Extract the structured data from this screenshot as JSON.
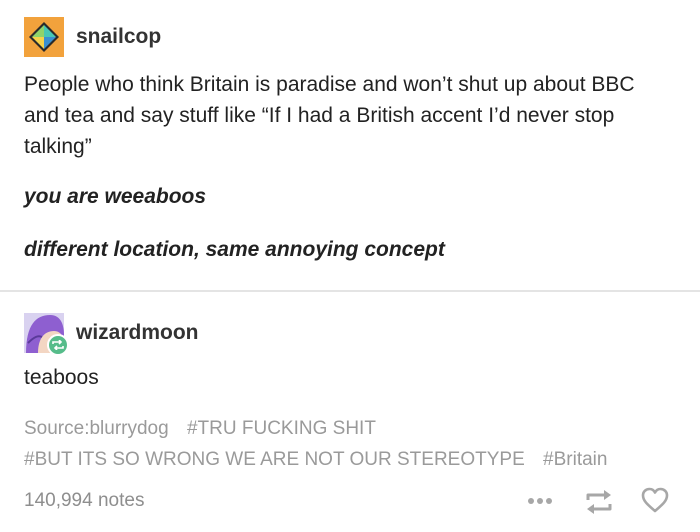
{
  "post": {
    "reblogs": [
      {
        "username": "snailcop",
        "avatar_icon": "geometric-logo-avatar",
        "body": "People who think Britain is paradise and won’t shut up about BBC and tea and say stuff like “If I had a British accent I’d never stop talking”",
        "emphasis": [
          "you are weeaboos",
          "different location, same annoying concept"
        ]
      },
      {
        "username": "wizardmoon",
        "avatar_icon": "purple-hair-character-avatar",
        "badge_icon": "reblog-badge-icon",
        "body": "teaboos"
      }
    ],
    "source_label": "Source:",
    "source_name": "blurrydog",
    "tags": [
      "#TRU FUCKING SHIT",
      "#BUT ITS SO WRONG WE ARE NOT OUR STEREOTYPE",
      "#Britain"
    ],
    "notes": "140,994 notes",
    "actions": [
      "more-icon",
      "reblog-icon",
      "heart-icon"
    ]
  },
  "colors": {
    "text": "#222222",
    "tags": "#9a9a9a",
    "notes": "#8e8e8e",
    "avatar1_bg": "#f2a23c",
    "badge_green": "#56bc8a",
    "divider": "#e4e4e4"
  }
}
